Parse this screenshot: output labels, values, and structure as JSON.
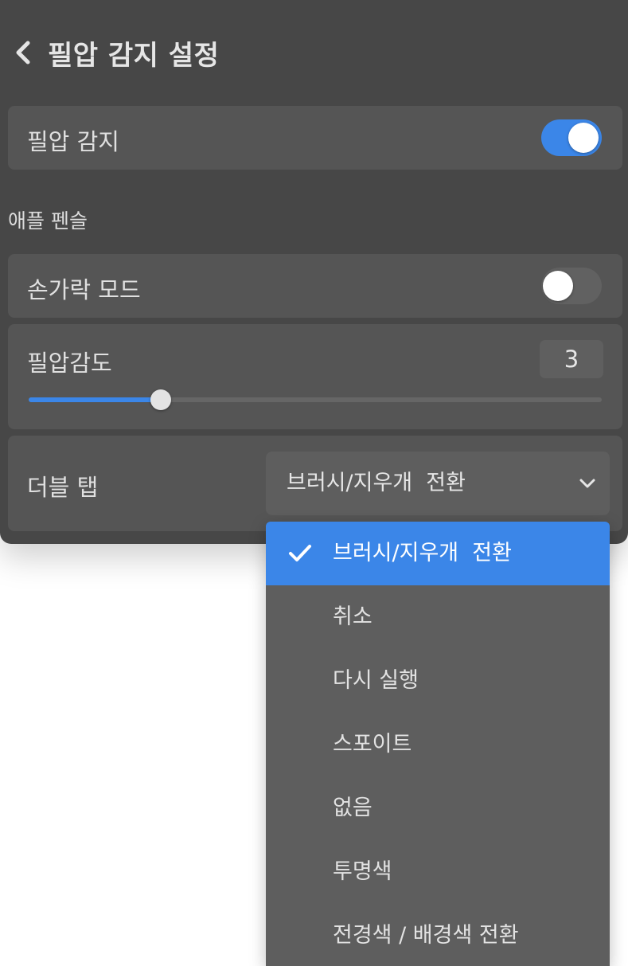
{
  "header": {
    "title": "필압 감지 설정",
    "back_icon": "chevron-left-icon"
  },
  "pressure": {
    "label": "필압 감지",
    "enabled": true
  },
  "section": {
    "label": "애플 펜슬"
  },
  "finger_mode": {
    "label": "손가락 모드",
    "enabled": false
  },
  "sensitivity": {
    "label": "필압감도",
    "value": "3",
    "level_fraction": 0.23
  },
  "double_tap": {
    "label": "더블 탭",
    "selected": "브러시/지우개  전환",
    "options": [
      "브러시/지우개  전환",
      "취소",
      "다시 실행",
      "스포이트",
      "없음",
      "투명색",
      "전경색 / 배경색 전환"
    ],
    "selected_index": 0
  },
  "colors": {
    "accent": "#3b86e8",
    "panel": "#474747",
    "row": "#555555"
  }
}
